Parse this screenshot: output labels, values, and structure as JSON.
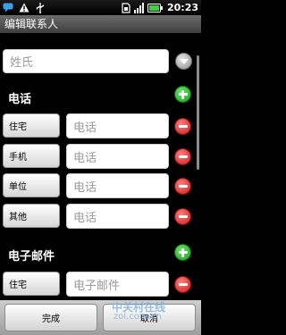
{
  "status_bar": {
    "time": "20:23",
    "icons": [
      "chat-icon",
      "warning-icon",
      "usb-icon",
      "sim-icon",
      "signal-icon",
      "battery-icon"
    ]
  },
  "title": "编辑联系人",
  "surname_placeholder": "姓氏",
  "phone_section": {
    "header": "电话",
    "rows": [
      {
        "type": "住宅",
        "placeholder": "电话"
      },
      {
        "type": "手机",
        "placeholder": "电话"
      },
      {
        "type": "单位",
        "placeholder": "电话"
      },
      {
        "type": "其他",
        "placeholder": "电话"
      }
    ]
  },
  "email_section": {
    "header": "电子邮件",
    "rows": [
      {
        "type": "住宅",
        "placeholder": "电子邮件"
      }
    ]
  },
  "buttons": {
    "done": "完成",
    "cancel": "取消"
  },
  "watermark": {
    "brand": "中关村在线",
    "url": "zol.com.cn"
  },
  "colors": {
    "add": "#1c9a1c",
    "remove": "#c71b1b",
    "title_bar": "#4e4e4e"
  }
}
